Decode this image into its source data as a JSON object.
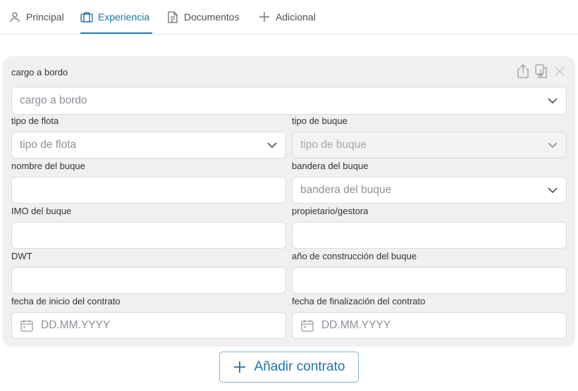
{
  "tabs": [
    {
      "label": "Principal",
      "icon": "user-icon"
    },
    {
      "label": "Experiencia",
      "icon": "briefcase-icon",
      "active": true
    },
    {
      "label": "Documentos",
      "icon": "document-icon"
    },
    {
      "label": "Adicional",
      "icon": "plus-icon"
    }
  ],
  "form": {
    "cargo": {
      "label": "cargo a bordo",
      "placeholder": "cargo a bordo"
    },
    "tipo_flota": {
      "label": "tipo de flota",
      "placeholder": "tipo de flota"
    },
    "tipo_buque": {
      "label": "tipo de buque",
      "placeholder": "tipo de buque"
    },
    "nombre_buque": {
      "label": "nombre del buque",
      "value": ""
    },
    "bandera_buque": {
      "label": "bandera del buque",
      "placeholder": "bandera del buque"
    },
    "imo": {
      "label": "IMO del buque",
      "value": ""
    },
    "propietario": {
      "label": "propietario/gestora",
      "value": ""
    },
    "dwt": {
      "label": "DWT",
      "value": ""
    },
    "anio_construccion": {
      "label": "año de construcción del buque",
      "value": ""
    },
    "fecha_inicio": {
      "label": "fecha de inicio del contrato",
      "placeholder": "DD.MM.YYYY"
    },
    "fecha_fin": {
      "label": "fecha de finalización del contrato",
      "placeholder": "DD.MM.YYYY"
    }
  },
  "add_contract_label": "Añadir contrato",
  "colors": {
    "accent": "#1f73a8",
    "card_bg": "#f0f0f1",
    "border": "#d8dbe0"
  }
}
